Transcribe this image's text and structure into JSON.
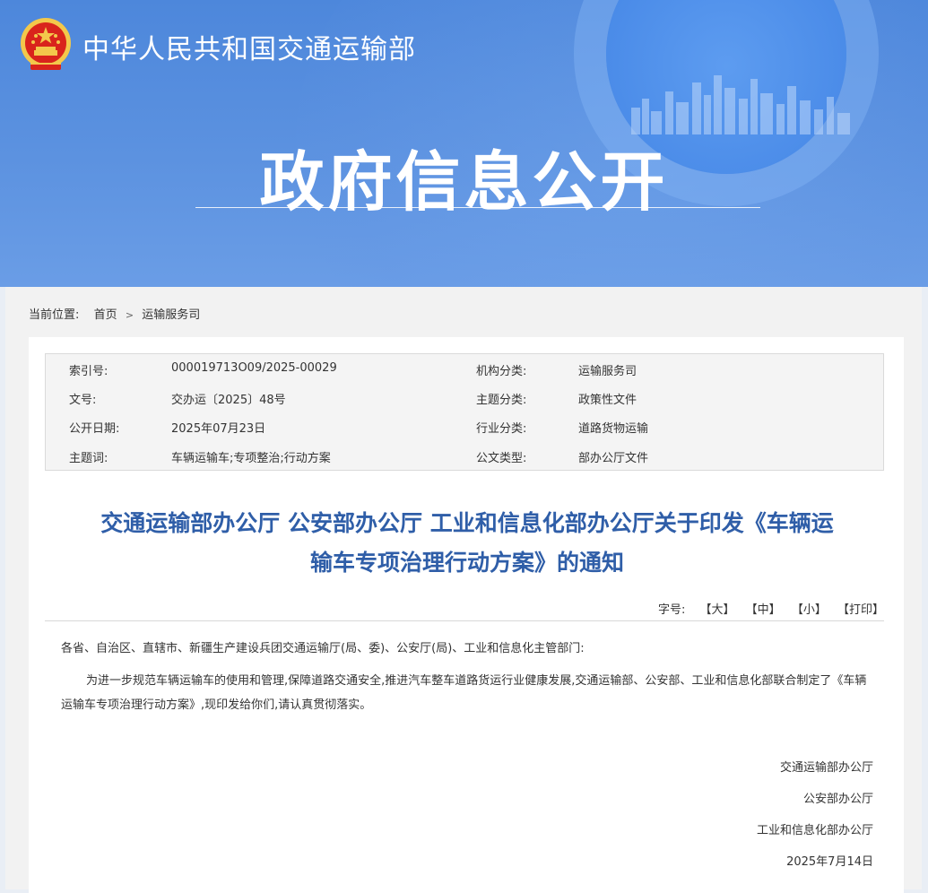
{
  "header": {
    "ministry_name": "中华人民共和国交通运输部",
    "banner_title": "政府信息公开",
    "colors": {
      "banner": "#4d87db",
      "title_blue": "#2f5ea8",
      "emblem_red": "#d9241c",
      "emblem_gold": "#f3c84b"
    }
  },
  "breadcrumb": {
    "label": "当前位置:",
    "items": [
      "首页",
      "运输服务司"
    ],
    "separator": ">"
  },
  "meta": {
    "rows": [
      {
        "label1": "索引号:",
        "value1": "000019713O09/2025-00029",
        "label2": "机构分类:",
        "value2": "运输服务司"
      },
      {
        "label1": "文号:",
        "value1": "交办运〔2025〕48号",
        "label2": "主题分类:",
        "value2": "政策性文件"
      },
      {
        "label1": "公开日期:",
        "value1": "2025年07月23日",
        "label2": "行业分类:",
        "value2": "道路货物运输"
      },
      {
        "label1": "主题词:",
        "value1": "车辆运输车;专项整治;行动方案",
        "label2": "公文类型:",
        "value2": "部办公厅文件"
      }
    ]
  },
  "article": {
    "title_line1": "交通运输部办公厅 公安部办公厅 工业和信息化部办公厅关于印发《车辆运",
    "title_line2": "输车专项治理行动方案》的通知",
    "tools": {
      "label": "字号:",
      "large": "【大】",
      "medium": "【中】",
      "small": "【小】",
      "print": "【打印】"
    },
    "greeting": "各省、自治区、直辖市、新疆生产建设兵团交通运输厅(局、委)、公安厅(局)、工业和信息化主管部门:",
    "paragraph": "为进一步规范车辆运输车的使用和管理,保障道路交通安全,推进汽车整车道路货运行业健康发展,交通运输部、公安部、工业和信息化部联合制定了《车辆运输车专项治理行动方案》,现印发给你们,请认真贯彻落实。",
    "signatures": [
      "交通运输部办公厅",
      "公安部办公厅",
      "工业和信息化部办公厅"
    ],
    "date": "2025年7月14日"
  }
}
